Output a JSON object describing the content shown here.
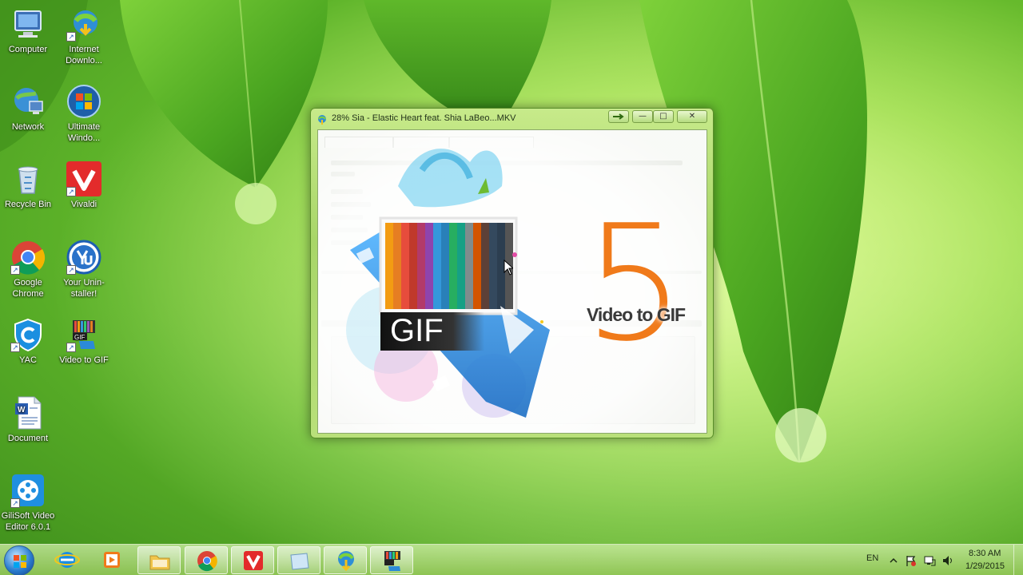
{
  "desktop": {
    "icons": [
      {
        "label": "Computer",
        "icon": "computer-icon"
      },
      {
        "label": "Internet Downlo...",
        "icon": "internet-download-manager-icon"
      },
      {
        "label": "Network",
        "icon": "network-icon"
      },
      {
        "label": "Ultimate Windo...",
        "icon": "ultimate-windows-icon"
      },
      {
        "label": "Recycle Bin",
        "icon": "recycle-bin-icon"
      },
      {
        "label": "Vivaldi",
        "icon": "vivaldi-icon"
      },
      {
        "label": "Google Chrome",
        "icon": "chrome-icon"
      },
      {
        "label": "Your Unin-staller!",
        "icon": "your-uninstaller-icon"
      },
      {
        "label": "YAC",
        "icon": "yac-icon"
      },
      {
        "label": "Video to GIF",
        "icon": "video-to-gif-icon"
      },
      {
        "label": "Document",
        "icon": "word-document-icon"
      },
      {
        "label": "GiliSoft Video Editor 6.0.1",
        "icon": "gilisoft-video-editor-icon"
      }
    ]
  },
  "window": {
    "title": "28% Sia - Elastic Heart feat. Shia LaBeo...MKV",
    "buttons": {
      "minimize": "—",
      "maximize": "□",
      "close": "✕"
    },
    "splash": {
      "badge_text": "GIF",
      "big_number": "5",
      "product_name": "Video to GIF"
    }
  },
  "taskbar": {
    "apps": [
      {
        "name": "internet-explorer-icon"
      },
      {
        "name": "media-player-icon"
      },
      {
        "name": "file-explorer-icon"
      },
      {
        "name": "chrome-icon"
      },
      {
        "name": "vivaldi-icon"
      },
      {
        "name": "blank-window-icon"
      },
      {
        "name": "internet-download-manager-icon"
      },
      {
        "name": "video-to-gif-icon"
      }
    ],
    "language": "EN",
    "time": "8:30 AM",
    "date": "1/29/2015"
  },
  "colors": {
    "accent_orange": "#f07a1a",
    "vivaldi_red": "#e32b2b",
    "wallpaper_green": "#6cbf2a"
  }
}
